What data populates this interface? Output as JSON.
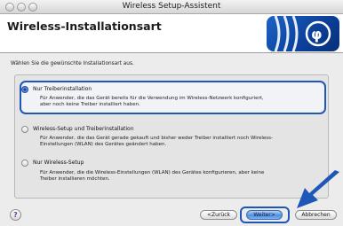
{
  "window": {
    "title": "Wireless Setup-Assistent"
  },
  "header": {
    "title": "Wireless-Installationsart",
    "logo": "wireless-logo"
  },
  "main": {
    "prompt": "Wählen Sie die gewünschte Installationsart aus.",
    "options": [
      {
        "label": "Nur Treiberinstallation",
        "desc_line1": "Für Anwender, die das Gerät bereits für die Verwendung im Wireless-Netzwerk konfiguriert,",
        "desc_line2": "aber noch keine Treiber installiert haben.",
        "selected": true
      },
      {
        "label": "Wireless-Setup und Treiberinstallation",
        "desc_line1": "Für Anwender, die das Gerät gerade gekauft und bisher weder Treiber installiert noch Wireless-",
        "desc_line2": "Einstellungen (WLAN) des Gerätes geändert haben.",
        "selected": false
      },
      {
        "label": "Nur Wireless-Setup",
        "desc_line1": "Für Anwender, die die Wireless-Einstellungen (WLAN) des Gerätes konfigurieren, aber keine",
        "desc_line2": "Treiber installieren möchten.",
        "selected": false
      }
    ]
  },
  "footer": {
    "help": "?",
    "back_label": "<Zurück",
    "next_label": "Weiter>",
    "cancel_label": "Abbrechen"
  },
  "colors": {
    "accent": "#1f57b8",
    "logo_blue": "#0a3f9a"
  }
}
